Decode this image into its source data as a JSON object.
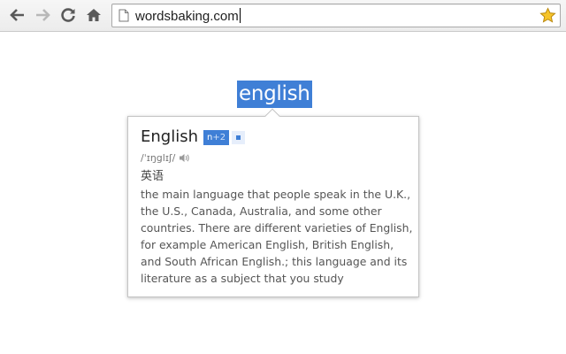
{
  "browser": {
    "url": "wordsbaking.com",
    "icons": {
      "back": "arrow-left-icon",
      "forward": "arrow-right-icon",
      "reload": "reload-icon",
      "home": "home-icon",
      "page": "page-icon",
      "bookmark": "star-icon"
    }
  },
  "page": {
    "selected_word": "english",
    "selection_color": "#3f7fd6"
  },
  "popup": {
    "headword": "English",
    "level_badge": {
      "prefix": "n",
      "suffix": "+2"
    },
    "phonetic": "/ˈɪŋglɪʃ/",
    "translation": "英语",
    "definition_lines": [
      "the main language that people speak in the U.K.,",
      "the U.S., Canada, Australia, and some other",
      "countries. There are different varieties of English,",
      "for example American English, British English,",
      "and South African English.; this language and its",
      "literature as a subject that you study"
    ],
    "icons": {
      "pronounce": "speaker-icon",
      "add": "add-word-icon"
    }
  }
}
